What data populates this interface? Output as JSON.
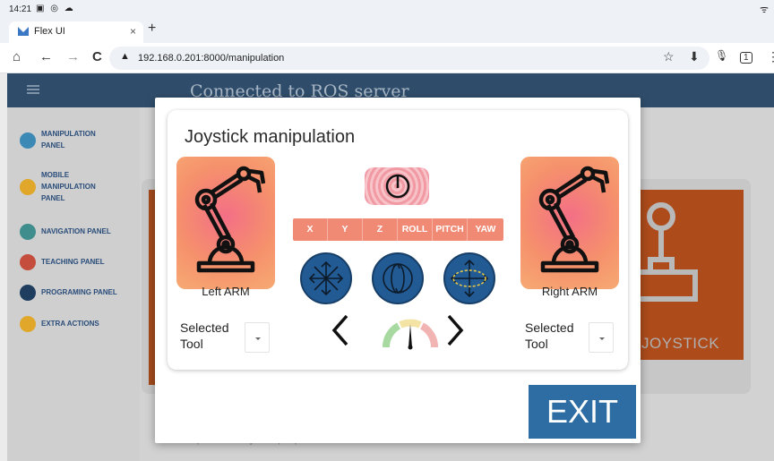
{
  "status": {
    "time": "14:21",
    "icons": "▣ ◎ ☁",
    "wifi": "ᯤ"
  },
  "browser": {
    "tab_title": "Flex UI",
    "tab_close": "×",
    "new_tab": "+",
    "home": "⌂",
    "back": "←",
    "forward": "→",
    "reload": "C",
    "warning": "▲",
    "url": "192.168.0.201:8000/manipulation",
    "bookmark": "☆",
    "download": "⬇",
    "mic": "🎙",
    "tabs_count": "1",
    "menu": "⋮"
  },
  "app": {
    "header_title": "Connected to ROS server",
    "sidebar": [
      {
        "label": "MANIPULATION\nPANEL",
        "icon": "manipulation-icon",
        "color": "#3c89b6"
      },
      {
        "label": "MOBILE\nMANIPULATION\nPANEL",
        "icon": "mobile-icon",
        "color": "#e0a72a"
      },
      {
        "label": "NAVIGATION PANEL",
        "icon": "navigation-icon",
        "color": "#3f8d8c"
      },
      {
        "label": "TEACHING PANEL",
        "icon": "teaching-icon",
        "color": "#c44d3e"
      },
      {
        "label": "PROGRAMING PANEL",
        "icon": "programming-icon",
        "color": "#1f3d5f"
      },
      {
        "label": "EXTRA ACTIONS",
        "icon": "extra-icon",
        "color": "#e0a72a"
      }
    ],
    "joystick_tile_label": "JOYSTICK",
    "footer_note": "No robot developer was harmed during the development process."
  },
  "modal": {
    "title": "Joystick manipulation",
    "left_arm_label": "Left ARM",
    "right_arm_label": "Right ARM",
    "left_tool_label": "Selected\nTool",
    "right_tool_label": "Selected\nTool",
    "axes": [
      "X",
      "Y",
      "Z",
      "ROLL",
      "PITCH",
      "YAW"
    ],
    "modes": [
      "translation-mode-icon",
      "rotation-mode-icon",
      "combined-mode-icon"
    ],
    "speed_level": 0.5,
    "exit_label": "EXIT",
    "colors": {
      "arm_card": "#f5906c",
      "axis_row": "#f08a74",
      "mode_icon": "#225a94",
      "exit": "#2e6da3"
    }
  }
}
